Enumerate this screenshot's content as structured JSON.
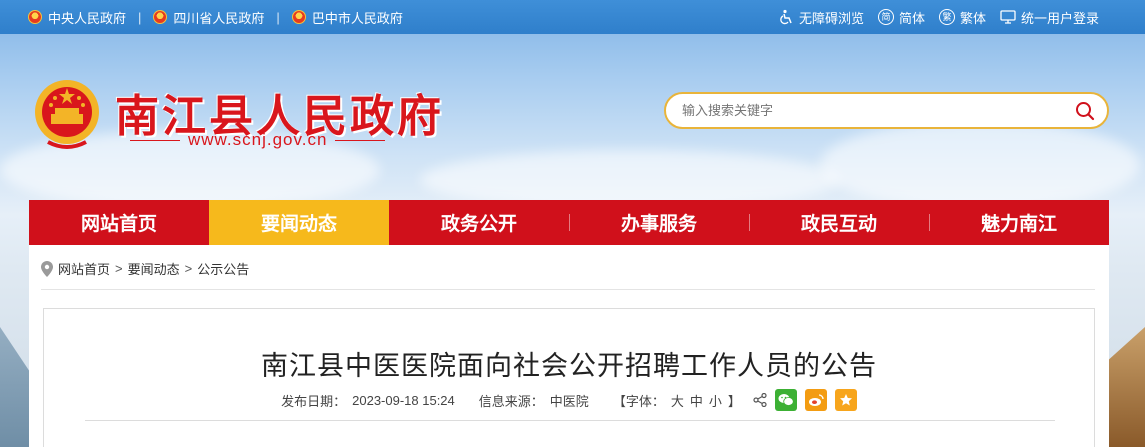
{
  "topbar": {
    "links": [
      "中央人民政府",
      "四川省人民政府",
      "巴中市人民政府"
    ],
    "separator": "|",
    "accessible": "无障碍浏览",
    "simplified_icon": "简",
    "simplified": "简体",
    "traditional_icon": "繁",
    "traditional": "繁体",
    "login": "统一用户登录"
  },
  "header": {
    "title": "南江县人民政府",
    "url": "www.scnj.gov.cn",
    "search_placeholder": "输入搜索关键字"
  },
  "nav": {
    "items": [
      "网站首页",
      "要闻动态",
      "政务公开",
      "办事服务",
      "政民互动",
      "魅力南江"
    ],
    "active": "要闻动态"
  },
  "breadcrumb": {
    "items": [
      "网站首页",
      "要闻动态",
      "公示公告"
    ],
    "separator": ">"
  },
  "article": {
    "title": "南江县中医医院面向社会公开招聘工作人员的公告",
    "date_label": "发布日期：",
    "date": "2023-09-18 15:24",
    "source_label": "信息来源：",
    "source": "中医院",
    "font_label": "【字体：",
    "font_large": "大",
    "font_medium": "中",
    "font_small": "小",
    "font_close": "】"
  },
  "colors": {
    "brand_red": "#d0101b",
    "active_yellow": "#f6b91c",
    "topbar_blue": "#3a8ad4",
    "wechat_green": "#3cb034",
    "weibo_orange": "#f39c12",
    "favorite_orange": "#f7a51c"
  },
  "icons": [
    "emblem-icon",
    "accessibility-icon",
    "monitor-icon",
    "search-icon",
    "location-pin-icon",
    "share-icon",
    "wechat-icon",
    "weibo-icon",
    "star-icon"
  ]
}
